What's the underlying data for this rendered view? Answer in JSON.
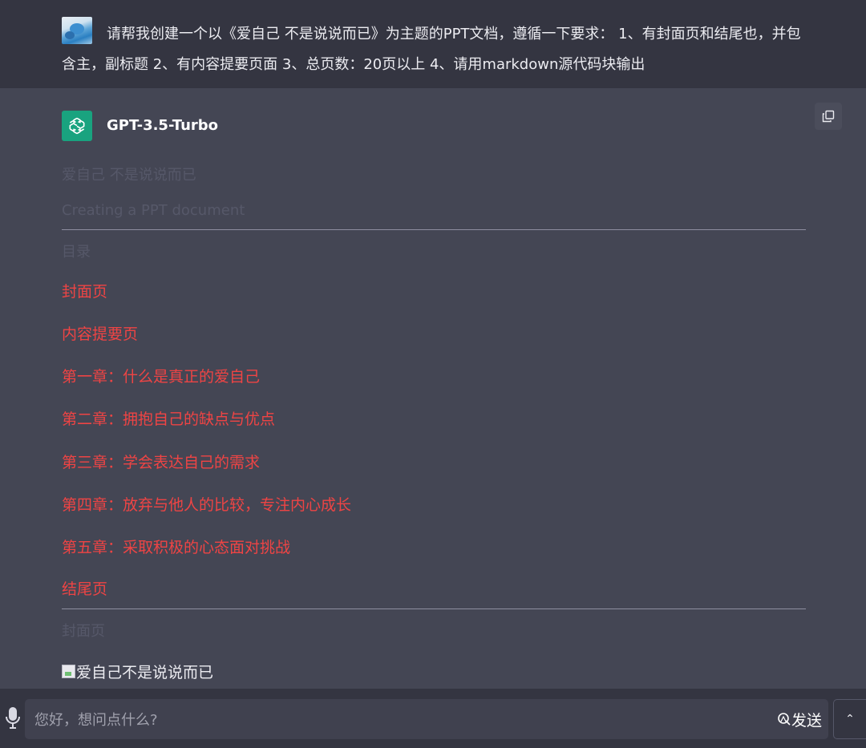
{
  "user_message": {
    "text": "请帮我创建一个以《爱自己 不是说说而已》为主题的PPT文档，遵循一下要求： 1、有封面页和结尾也，并包含主，副标题 2、有内容提要页面 3、总页数：20页以上 4、请用markdown源代码块输出"
  },
  "bot": {
    "name": "GPT-3.5-Turbo",
    "heading_faded": "爱自己 不是说说而已",
    "subheading_faded": "Creating a PPT document",
    "section_label_1": "目录",
    "toc": [
      "封面页",
      "内容提要页",
      "第一章：什么是真正的爱自己",
      "第二章：拥抱自己的缺点与优点",
      "第三章：学会表达自己的需求",
      "第四章：放弃与他人的比较，专注内心成长",
      "第五章：采取积极的心态面对挑战",
      "结尾页"
    ],
    "section_label_2": "封面页",
    "image_alt": "爱自己不是说说而已"
  },
  "composer": {
    "placeholder": "您好，想问点什么?",
    "send_label": "发送",
    "scroll_top_glyph": "⌃"
  },
  "colors": {
    "page_bg": "#444654",
    "user_bg": "#343541",
    "link_red": "#ef4444",
    "bot_avatar": "#19a37f"
  }
}
